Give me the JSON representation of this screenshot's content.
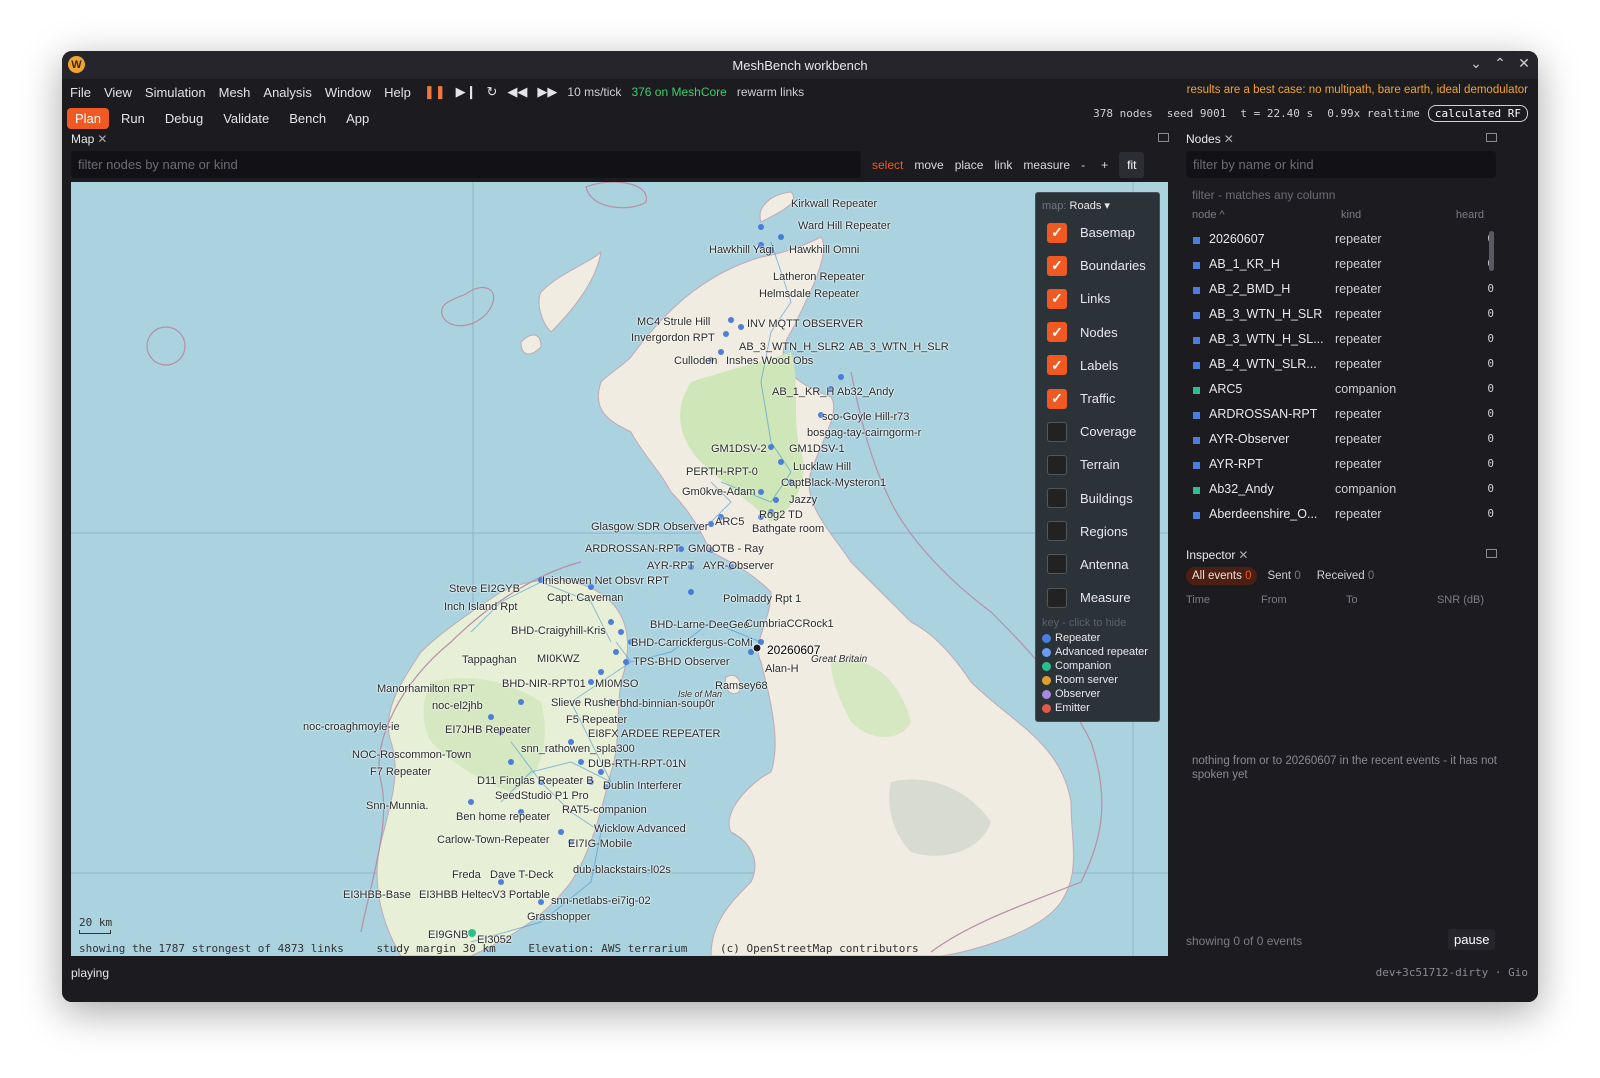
{
  "window": {
    "title": "MeshBench workbench",
    "logo": "W"
  },
  "menu": [
    "File",
    "View",
    "Simulation",
    "Mesh",
    "Analysis",
    "Window",
    "Help"
  ],
  "playback": {
    "tick": "10 ms/tick",
    "mesh": "376 on MeshCore",
    "rewarm": "rewarm links"
  },
  "warning": "results are a best case: no multipath, bare earth, ideal demodulator",
  "modes": [
    "Plan",
    "Run",
    "Debug",
    "Validate",
    "Bench",
    "App"
  ],
  "active_mode": "Plan",
  "stats": {
    "nodes": "378 nodes",
    "seed": "seed 9001",
    "time": "t = 22.40 s",
    "rate": "0.99x realtime",
    "badge": "calculated RF"
  },
  "map_panel": {
    "title": "Map",
    "search_placeholder": "filter nodes by name or kind",
    "tools": [
      "select",
      "move",
      "place",
      "link",
      "measure",
      "-",
      "+",
      "fit"
    ],
    "active_tool": "select",
    "layer_header_prefix": "map:",
    "layer_basemap": "Roads",
    "layers": [
      {
        "label": "Basemap",
        "on": true
      },
      {
        "label": "Boundaries",
        "on": true
      },
      {
        "label": "Links",
        "on": true
      },
      {
        "label": "Nodes",
        "on": true
      },
      {
        "label": "Labels",
        "on": true
      },
      {
        "label": "Traffic",
        "on": true
      },
      {
        "label": "Coverage",
        "on": false
      },
      {
        "label": "Terrain",
        "on": false
      },
      {
        "label": "Buildings",
        "on": false
      },
      {
        "label": "Regions",
        "on": false
      },
      {
        "label": "Antenna",
        "on": false
      },
      {
        "label": "Measure",
        "on": false
      }
    ],
    "key_hint": "key - click to hide",
    "key": [
      {
        "label": "Repeater",
        "color": "#4a7de0"
      },
      {
        "label": "Advanced repeater",
        "color": "#6a9cf0"
      },
      {
        "label": "Companion",
        "color": "#2bbf8f"
      },
      {
        "label": "Room server",
        "color": "#e0a030"
      },
      {
        "label": "Observer",
        "color": "#a68ae0"
      },
      {
        "label": "Emitter",
        "color": "#e05a4a"
      }
    ],
    "scale": "20 km",
    "footer": {
      "links": "showing the 1787 strongest of 4873 links",
      "margin": "study margin 30 km",
      "elevation": "Elevation: AWS terrarium",
      "credit": "(c) OpenStreetMap contributors"
    },
    "labels": [
      "Kirkwall Repeater",
      "Ward Hill Repeater",
      "Hawkhill Yagi",
      "Hawkhill Omni",
      "Latheron Repeater",
      "Helmsdale Repeater",
      "MC4 Strule Hill",
      "INV MQTT OBSERVER",
      "Invergordon RPT",
      "AB_3_WTN_H_SLR2",
      "AB_3_WTN_H_SLR",
      "Culloden",
      "Inshes Wood Obs",
      "AB_1_KR_H",
      "Ab32_Andy",
      "sco-Goyle Hill-r73",
      "bosgag-tay-cairngorm-r",
      "GM1DSV-2",
      "GM1DSV-1",
      "PERTH-RPT-0",
      "Lucklaw Hill",
      "CaptBlack-Mysteron1",
      "Gm0kve-Adam",
      "Jazzy",
      "ARC5",
      "Rog2 TD",
      "Glasgow SDR Observer",
      "Bathgate room",
      "ARDROSSAN-RPT",
      "GM0OTB - Ray",
      "AYR-RPT",
      "AYR-Observer",
      "Steve EI2GYB",
      "Inishowen Net Obsvr RPT",
      "Capt. Caveman",
      "Inch Island Rpt",
      "Polmaddy Rpt 1",
      "BHD-Craigyhill-Kris",
      "BHD-Larne-DeeGee",
      "CumbriaCCRock1",
      "BHD-Carrickfergus-CoMi",
      "20260607",
      "Tappaghan",
      "MI0KWZ",
      "TPS-BHD Observer",
      "Alan-H",
      "Great Britain",
      "Manorhamilton RPT",
      "BHD-NIR-RPT01",
      "MI0MSO",
      "Ramsey68",
      "noc-el2jhb",
      "Slieve Rushen",
      "bhd-binnian-soup0r",
      "Isle of Man",
      "noc-croaghmoyle-ie",
      "EI7JHB Repeater",
      "F5 Repeater",
      "EI8FX ARDEE REPEATER",
      "NOC-Roscommon-Town",
      "snn_rathowen_spla300",
      "F7 Repeater",
      "DUB-RTH-RPT-01N",
      "Dublin Interferer",
      "D11 Finglas Repeater B",
      "SeedStudio P1 Pro",
      "Snn-Munnia.",
      "RAT5-companion",
      "Ben home repeater",
      "Wicklow Advanced",
      "Carlow-Town-Repeater",
      "EI7IG-Mobile",
      "Freda",
      "Dave T-Deck",
      "dub-blackstairs-l02s",
      "EI3HBB-Base",
      "EI3HBB HeltecV3 Portable",
      "snn-netlabs-ei7ig-02",
      "Grasshopper",
      "EI9GNB",
      "EI3052"
    ]
  },
  "nodes_panel": {
    "title": "Nodes",
    "search_placeholder": "filter by name or kind",
    "hint": "filter - matches any column",
    "columns": [
      "node ^",
      "kind",
      "heard"
    ],
    "rows": [
      {
        "node": "20260607",
        "kind": "repeater",
        "heard": "0",
        "color": "#4a7de0"
      },
      {
        "node": "AB_1_KR_H",
        "kind": "repeater",
        "heard": "0",
        "color": "#4a7de0"
      },
      {
        "node": "AB_2_BMD_H",
        "kind": "repeater",
        "heard": "0",
        "color": "#4a7de0"
      },
      {
        "node": "AB_3_WTN_H_SLR",
        "kind": "repeater",
        "heard": "0",
        "color": "#4a7de0"
      },
      {
        "node": "AB_3_WTN_H_SL...",
        "kind": "repeater",
        "heard": "0",
        "color": "#4a7de0"
      },
      {
        "node": "AB_4_WTN_SLR...",
        "kind": "repeater",
        "heard": "0",
        "color": "#4a7de0"
      },
      {
        "node": "ARC5",
        "kind": "companion",
        "heard": "0",
        "color": "#2bbf8f"
      },
      {
        "node": "ARDROSSAN-RPT",
        "kind": "repeater",
        "heard": "0",
        "color": "#4a7de0"
      },
      {
        "node": "AYR-Observer",
        "kind": "repeater",
        "heard": "0",
        "color": "#4a7de0"
      },
      {
        "node": "AYR-RPT",
        "kind": "repeater",
        "heard": "0",
        "color": "#4a7de0"
      },
      {
        "node": "Ab32_Andy",
        "kind": "companion",
        "heard": "0",
        "color": "#2bbf8f"
      },
      {
        "node": "Aberdeenshire_O...",
        "kind": "repeater",
        "heard": "0",
        "color": "#4a7de0"
      }
    ]
  },
  "inspector": {
    "title": "Inspector",
    "tabs": [
      {
        "label": "All events",
        "count": "0"
      },
      {
        "label": "Sent",
        "count": "0"
      },
      {
        "label": "Received",
        "count": "0"
      }
    ],
    "columns": [
      "Time",
      "From",
      "To",
      "SNR (dB)"
    ],
    "empty": "nothing from or to 20260607 in the recent events - it has not spoken yet",
    "footer": "showing 0 of 0 events",
    "pause": "pause"
  },
  "status": {
    "state": "playing",
    "version": "dev+3c51712-dirty · Gio"
  }
}
